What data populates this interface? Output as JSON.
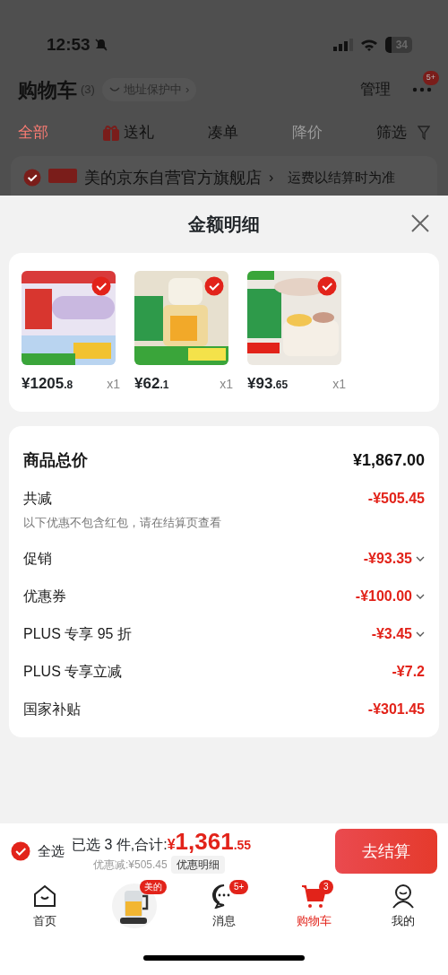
{
  "status_bar": {
    "time": "12:53",
    "battery": "34"
  },
  "header": {
    "title": "购物车",
    "count": "(3)",
    "address_chip": "地址保护中",
    "chevron": "›",
    "manage": "管理",
    "more_badge": "5+"
  },
  "filter_tabs": [
    {
      "label": "全部",
      "kind": "plain",
      "selected": true,
      "disabled": false
    },
    {
      "label": "送礼",
      "kind": "gift",
      "selected": false,
      "disabled": false
    },
    {
      "label": "凑单",
      "kind": "plain",
      "selected": false,
      "disabled": false
    },
    {
      "label": "降价",
      "kind": "plain",
      "selected": false,
      "disabled": true
    },
    {
      "label": "筛选",
      "kind": "filter",
      "selected": false,
      "disabled": false
    }
  ],
  "store_row": {
    "checked": true,
    "name": "美的京东自营官方旗舰店",
    "chevron": "›",
    "note": "运费以结算时为准"
  },
  "sheet": {
    "title": "金额明细",
    "products": [
      {
        "selected": true,
        "price": "¥1205",
        "price_decimal": ".8",
        "quantity": "x1"
      },
      {
        "selected": true,
        "price": "¥62",
        "price_decimal": ".1",
        "quantity": "x1"
      },
      {
        "selected": true,
        "price": "¥93",
        "price_decimal": ".65",
        "quantity": "x1"
      }
    ],
    "summary": [
      {
        "kind": "total",
        "label": "商品总价",
        "amount": "¥1,867.00",
        "expandable": false
      },
      {
        "kind": "reduction",
        "label": "共减",
        "amount": "-¥505.45",
        "note": "以下优惠不包含红包，请在结算页查看",
        "expandable": false
      },
      {
        "kind": "item",
        "label": "促销",
        "amount": "-¥93.35",
        "expandable": true
      },
      {
        "kind": "item",
        "label": "优惠券",
        "amount": "-¥100.00",
        "expandable": true
      },
      {
        "kind": "item",
        "label": "PLUS 专享 95 折",
        "amount": "-¥3.45",
        "expandable": true
      },
      {
        "kind": "item",
        "label": "PLUS 专享立减",
        "amount": "-¥7.2",
        "expandable": false
      },
      {
        "kind": "item",
        "label": "国家补贴",
        "amount": "-¥301.45",
        "expandable": false
      }
    ]
  },
  "checkout_bar": {
    "select_all_checked": true,
    "select_all": "全选",
    "selected_text": "已选 3 件,合计:",
    "currency": "¥",
    "total": "1,361",
    "total_decimal": ".55",
    "discount": "优惠减:¥505.45",
    "discount_detail": "优惠明细",
    "checkout": "去结算"
  },
  "tab_bar": [
    {
      "kind": "home",
      "label": "首页",
      "selected": false
    },
    {
      "kind": "product",
      "badge": "美的",
      "selected": false
    },
    {
      "kind": "message",
      "label": "消息",
      "badge": "5+",
      "selected": false
    },
    {
      "kind": "cart",
      "label": "购物车",
      "badge": "3",
      "selected": true
    },
    {
      "kind": "profile",
      "label": "我的",
      "selected": false
    }
  ]
}
